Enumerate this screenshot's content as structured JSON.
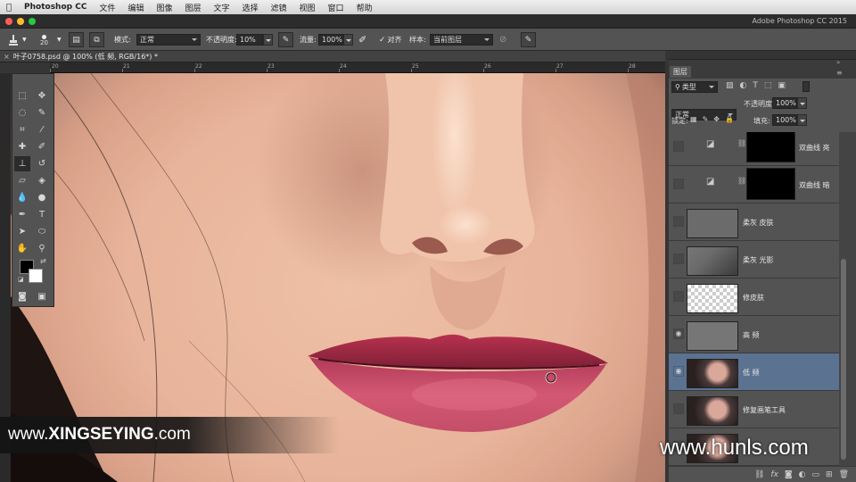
{
  "menubar": {
    "items": [
      "Photoshop CC",
      "文件",
      "编辑",
      "图像",
      "图层",
      "文字",
      "选择",
      "滤镜",
      "视图",
      "窗口",
      "帮助"
    ]
  },
  "window": {
    "title": "Adobe Photoshop CC 2015"
  },
  "options_bar": {
    "brush_size": "20",
    "mode_label": "模式:",
    "mode_value": "正常",
    "opacity_label": "不透明度:",
    "opacity_value": "10%",
    "flow_label": "流量:",
    "flow_value": "100%",
    "aligned_label": "对齐",
    "sample_label": "样本:",
    "sample_value": "当前图层"
  },
  "document": {
    "tab_title": "叶子0758.psd @ 100% (低 频, RGB/16*) *",
    "ruler_labels": [
      "20",
      "21",
      "22",
      "23",
      "24",
      "25",
      "26",
      "27",
      "28"
    ]
  },
  "layers_panel": {
    "tab_label": "图层",
    "filter_value": "类型",
    "blend_mode": "正常",
    "opacity_label": "不透明度:",
    "opacity_value": "100%",
    "lock_label": "锁定:",
    "fill_label": "填充:",
    "fill_value": "100%",
    "layers": [
      {
        "name": "双曲线 亮",
        "visible": false,
        "kind": "curves"
      },
      {
        "name": "双曲线 暗",
        "visible": false,
        "kind": "curves"
      },
      {
        "name": "柔灰 皮肤",
        "visible": false,
        "kind": "gray"
      },
      {
        "name": "柔灰 光影",
        "visible": false,
        "kind": "gradient"
      },
      {
        "name": "修皮肤",
        "visible": false,
        "kind": "transparent"
      },
      {
        "name": "高 频",
        "visible": true,
        "kind": "gray"
      },
      {
        "name": "低 频",
        "visible": true,
        "kind": "photo",
        "selected": true
      },
      {
        "name": "修复画笔工具",
        "visible": false,
        "kind": "photo"
      },
      {
        "name": "",
        "visible": false,
        "kind": "photo"
      }
    ]
  },
  "watermarks": {
    "left_prefix": "www.",
    "left_brand": "XINGSEYING",
    "left_suffix": ".com",
    "right": "www.hunls.com"
  },
  "colors": {
    "accent_selected_layer": "#5b7391",
    "panel_bg": "#535353",
    "lip": "#c0405e"
  }
}
